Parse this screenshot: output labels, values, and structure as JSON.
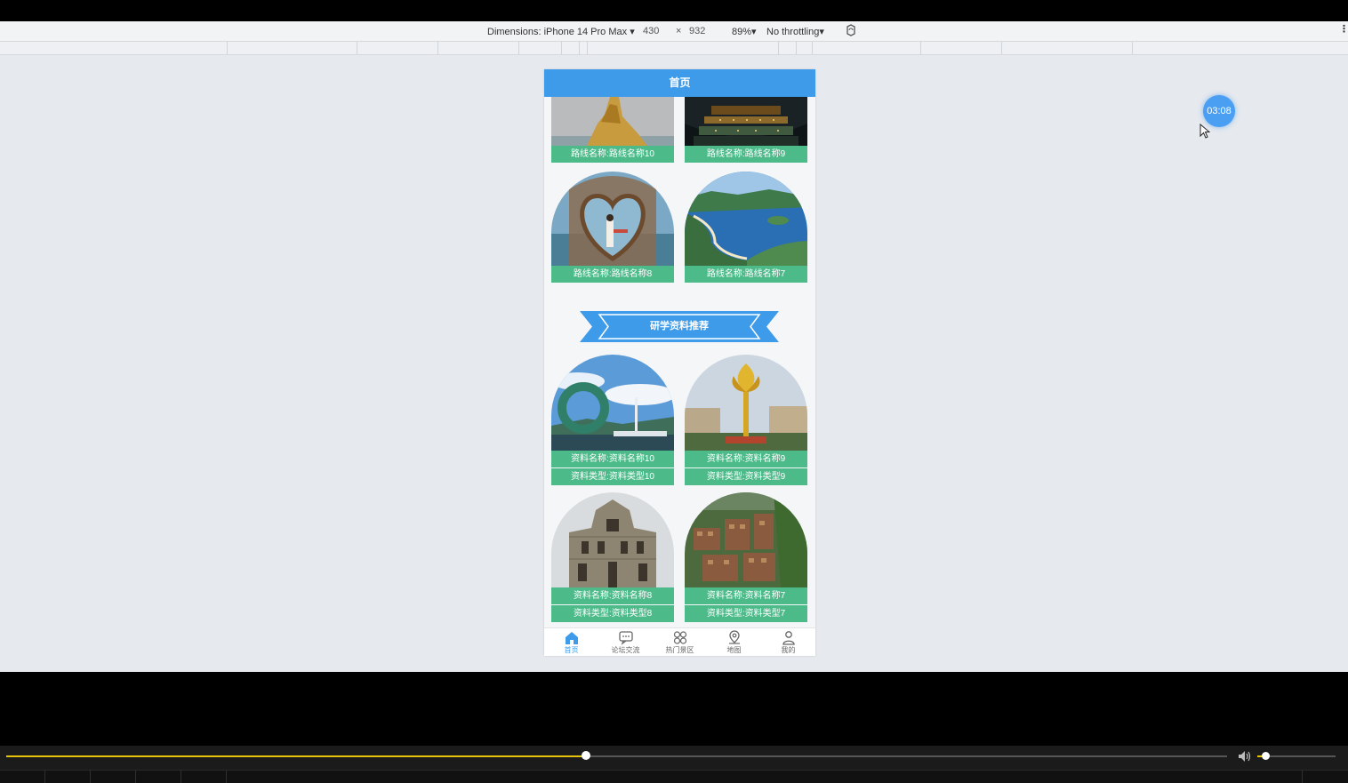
{
  "devtools": {
    "dimensions_label": "Dimensions: iPhone 14 Pro Max",
    "width_value": "430",
    "times": "×",
    "height_value": "932",
    "zoom": "89%",
    "throttling": "No throttling"
  },
  "app": {
    "header_title": "首页",
    "routes": [
      {
        "label": "路线名称:路线名称10"
      },
      {
        "label": "路线名称:路线名称9"
      },
      {
        "label": "路线名称:路线名称8"
      },
      {
        "label": "路线名称:路线名称7"
      }
    ],
    "section_title": "研学资料推荐",
    "materials": [
      {
        "name": "资料名称:资料名称10",
        "type": "资料类型:资料类型10"
      },
      {
        "name": "资料名称:资料名称9",
        "type": "资料类型:资料类型9"
      },
      {
        "name": "资料名称:资料名称8",
        "type": "资料类型:资料类型8"
      },
      {
        "name": "资料名称:资料名称7",
        "type": "资料类型:资料类型7"
      }
    ],
    "tabs": [
      {
        "label": "首页",
        "icon": "home-icon"
      },
      {
        "label": "论坛交流",
        "icon": "chat-icon"
      },
      {
        "label": "热门景区",
        "icon": "grid-icon"
      },
      {
        "label": "地图",
        "icon": "map-pin-icon"
      },
      {
        "label": "我的",
        "icon": "user-icon"
      }
    ]
  },
  "overlay": {
    "timer": "03:08"
  },
  "player": {
    "progress_percent": 47.5,
    "volume_percent": 10
  },
  "colors": {
    "primary": "#3d9bea",
    "label_green": "#4dba8a",
    "progress": "#e6c20a"
  }
}
